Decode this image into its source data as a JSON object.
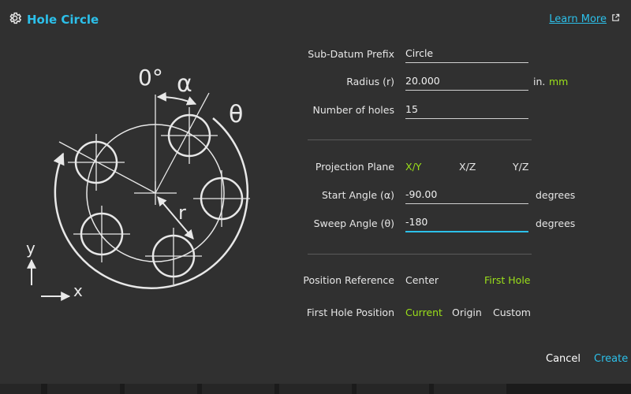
{
  "header": {
    "title": "Hole Circle",
    "learn_more": "Learn More"
  },
  "diagram": {
    "zero_label": "0°",
    "alpha": "α",
    "theta": "θ",
    "r": "r",
    "x_axis": "x",
    "y_axis": "y"
  },
  "form": {
    "sub_datum_prefix": {
      "label": "Sub-Datum Prefix",
      "value": "Circle"
    },
    "radius": {
      "label": "Radius (r)",
      "value": "20.000",
      "unit_in": "in.",
      "unit_mm": "mm"
    },
    "num_holes": {
      "label": "Number of holes",
      "value": "15"
    },
    "projection_plane": {
      "label": "Projection Plane",
      "options": [
        "X/Y",
        "X/Z",
        "Y/Z"
      ],
      "selected": "X/Y"
    },
    "start_angle": {
      "label": "Start Angle (α)",
      "value": "-90.00",
      "unit": "degrees"
    },
    "sweep_angle": {
      "label": "Sweep Angle (θ)",
      "value": "-180",
      "unit": "degrees"
    },
    "position_reference": {
      "label": "Position Reference",
      "options": [
        "Center",
        "First Hole"
      ],
      "selected": "First Hole"
    },
    "first_hole_position": {
      "label": "First Hole Position",
      "options": [
        "Current",
        "Origin",
        "Custom"
      ],
      "selected": "Current"
    }
  },
  "footer": {
    "cancel": "Cancel",
    "create": "Create"
  },
  "colors": {
    "accent": "#2cc0ea",
    "selected": "#9be01a",
    "background": "#303030"
  }
}
